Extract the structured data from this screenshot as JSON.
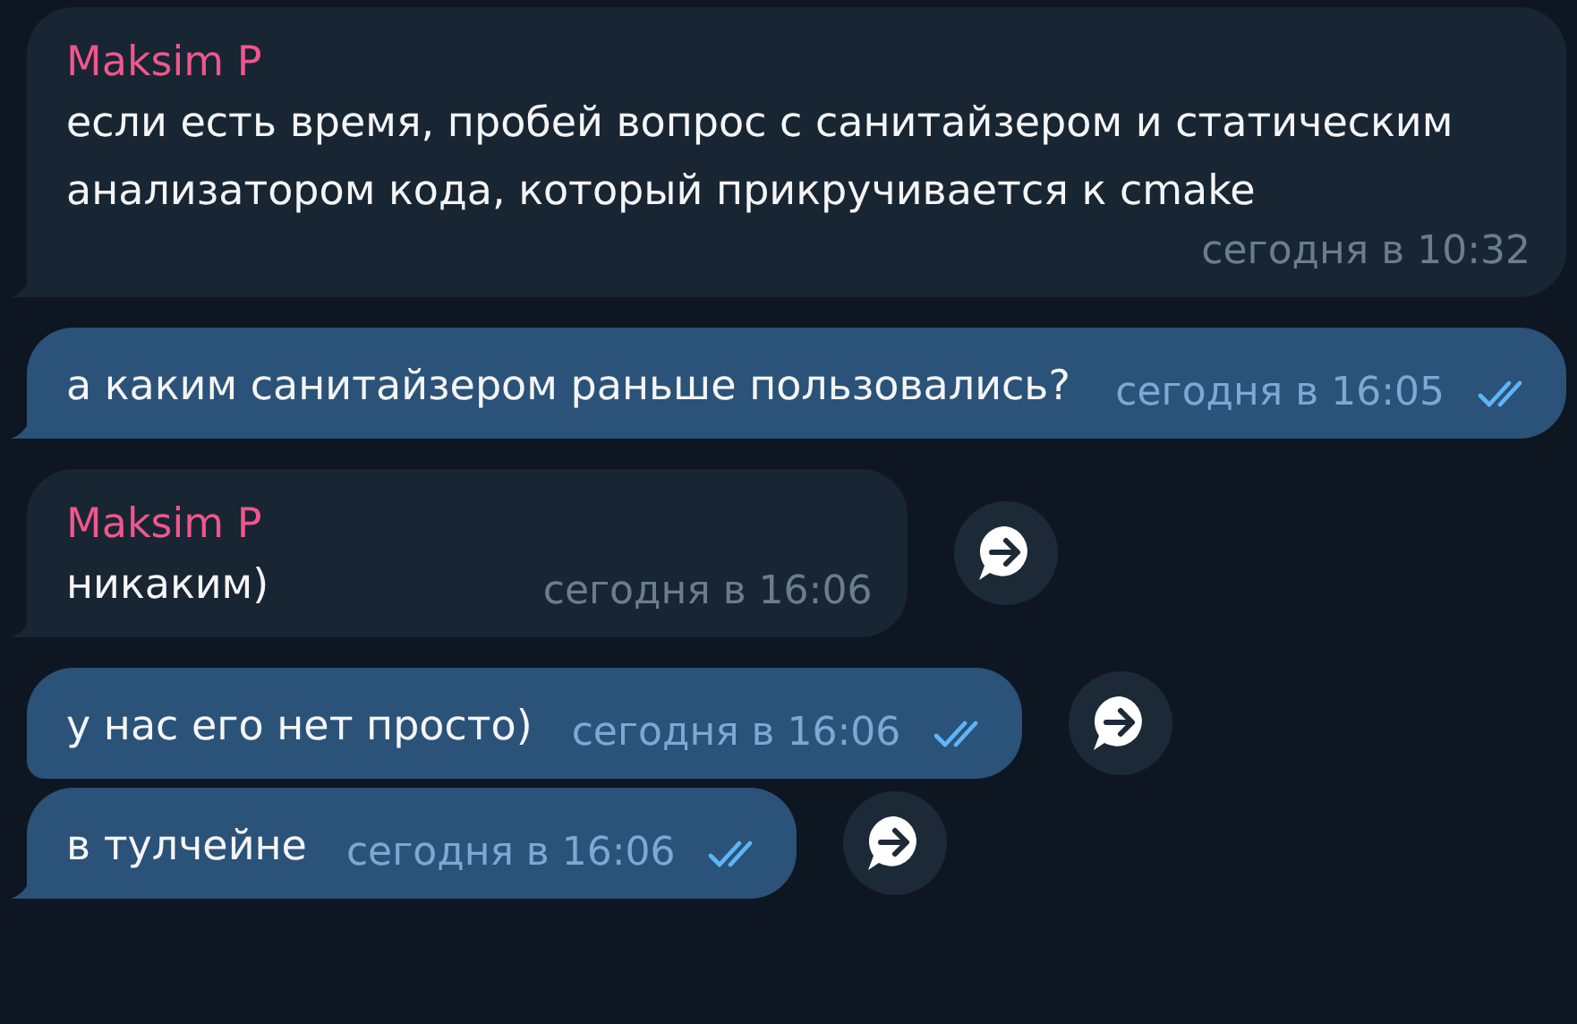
{
  "messages": [
    {
      "kind": "incoming",
      "sender": "Maksim P",
      "text": "если есть время, пробей вопрос с санитайзером и статическим анализатором кода, который прикручивается к cmake",
      "time": "сегодня в 10:32",
      "tail": true,
      "wide": true
    },
    {
      "kind": "outgoing",
      "text": "а каким санитайзером раньше пользовались?",
      "time": "сегодня в 16:05",
      "read": true,
      "tail": true,
      "wide": true
    },
    {
      "kind": "incoming",
      "sender": "Maksim P",
      "text": "никаким)",
      "time": "сегодня в 16:06",
      "tail": true,
      "wide": false,
      "share_button": true
    },
    {
      "kind": "outgoing",
      "text": "у нас его нет просто)",
      "time": "сегодня в 16:06",
      "read": true,
      "tail": false,
      "wide": false,
      "share_button": true
    },
    {
      "kind": "outgoing",
      "text": "в тулчейне",
      "time": "сегодня в 16:06",
      "read": true,
      "tail": true,
      "wide": false,
      "share_button": true
    }
  ]
}
